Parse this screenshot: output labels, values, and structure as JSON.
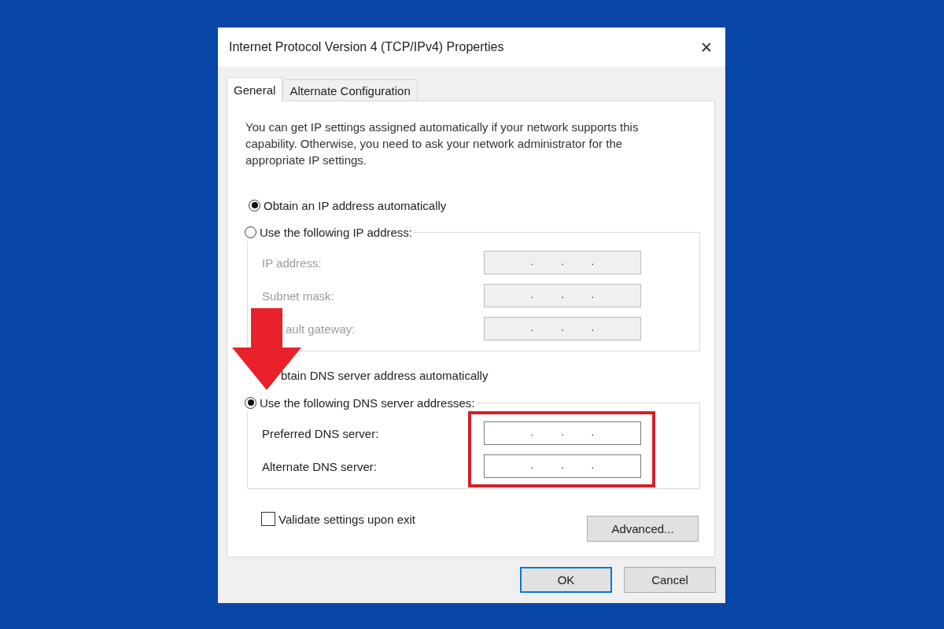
{
  "window": {
    "title": "Internet Protocol Version 4 (TCP/IPv4) Properties",
    "close": "✕"
  },
  "tabs": [
    {
      "label": "General",
      "selected": true
    },
    {
      "label": "Alternate Configuration",
      "selected": false
    }
  ],
  "intro": "You can get IP settings assigned automatically if your network supports this capability. Otherwise, you need to ask your network administrator for the appropriate IP settings.",
  "ip_choice": {
    "kind": "radio",
    "label": "Obtain an IP address automatically",
    "selected": true
  },
  "ip_group": {
    "kind": "radio",
    "label": "Use the following IP address:",
    "selected": false,
    "disabled": true,
    "fields": [
      {
        "label": "IP address:",
        "separators": [
          ".",
          ".",
          "."
        ]
      },
      {
        "label": "Subnet mask:",
        "separators": [
          ".",
          ".",
          "."
        ]
      },
      {
        "label": "ault gateway:",
        "separators": [
          ".",
          ".",
          "."
        ]
      }
    ]
  },
  "dns_choice": {
    "kind": "label",
    "label": "btain DNS server address automatically"
  },
  "dns_group": {
    "kind": "radio",
    "label": "Use the following DNS server addresses:",
    "selected": true,
    "disabled": false,
    "fields": [
      {
        "label": "Preferred DNS server:",
        "separators": [
          ".",
          ".",
          "."
        ]
      },
      {
        "label": "Alternate DNS server:",
        "separators": [
          ".",
          ".",
          "."
        ]
      }
    ]
  },
  "validate": {
    "label": "Validate settings upon exit",
    "checked": false
  },
  "advanced_button": "Advanced...",
  "buttons": [
    {
      "label": "OK",
      "default": true
    },
    {
      "label": "Cancel",
      "default": false
    }
  ]
}
